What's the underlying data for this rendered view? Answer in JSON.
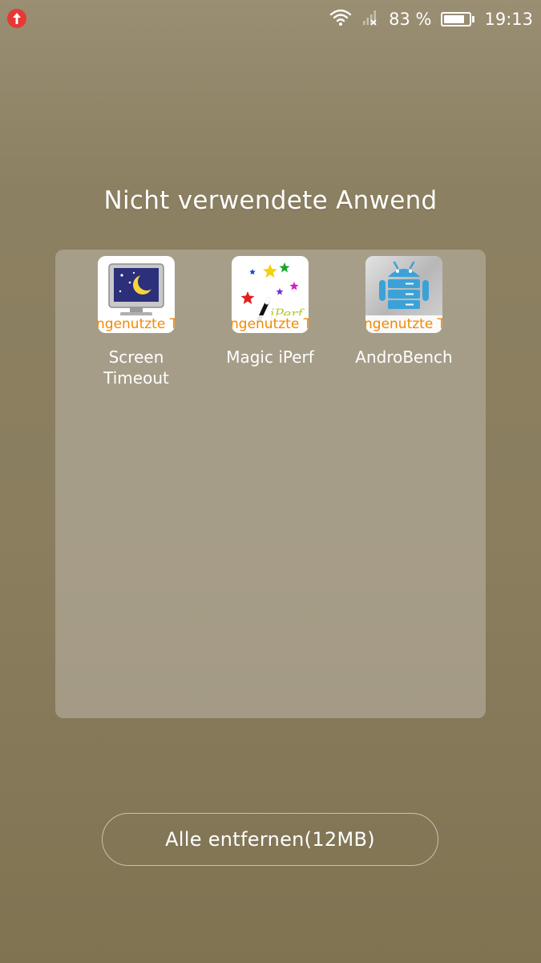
{
  "status_bar": {
    "notification_icon": "upload-arrow-icon",
    "wifi_icon": "wifi-icon",
    "signal_icon": "no-signal-icon",
    "battery_percent": "83 %",
    "battery_level": 0.83,
    "time": "19:13"
  },
  "folder": {
    "title": "Nicht verwendete Anwend",
    "apps": [
      {
        "label": "Screen\nTimeout",
        "icon": "screen-timeout-icon",
        "badge": "ngenutzte T"
      },
      {
        "label": "Magic iPerf",
        "icon": "magic-iperf-icon",
        "badge": "ngenutzte T"
      },
      {
        "label": "AndroBench",
        "icon": "androbench-icon",
        "badge": "ngenutzte T"
      }
    ]
  },
  "actions": {
    "remove_all_label": "Alle entfernen(12MB)"
  },
  "colors": {
    "badge_text": "#f08a00",
    "notification_dot": "#e53935"
  }
}
